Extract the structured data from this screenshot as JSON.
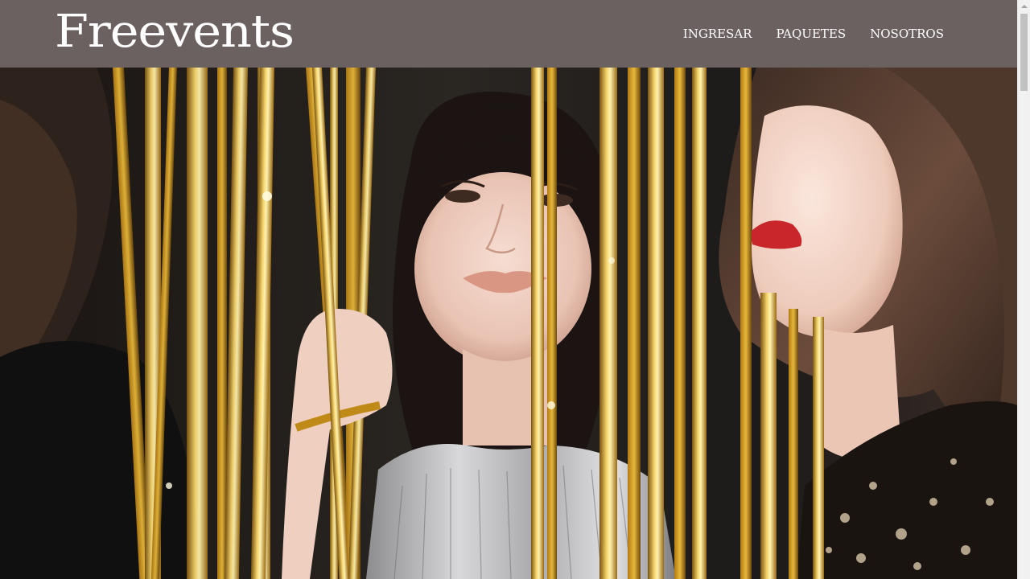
{
  "header": {
    "logo_text": "Freevents",
    "background_color": "#6b6160",
    "nav_items": [
      {
        "label": "INGRESAR"
      },
      {
        "label": "PAQUETES"
      },
      {
        "label": "NOSOTROS"
      }
    ]
  },
  "hero": {
    "image_icon": "party-photo-three-women-gold-tinsel-curtain",
    "accent_color": "#d9a520"
  }
}
